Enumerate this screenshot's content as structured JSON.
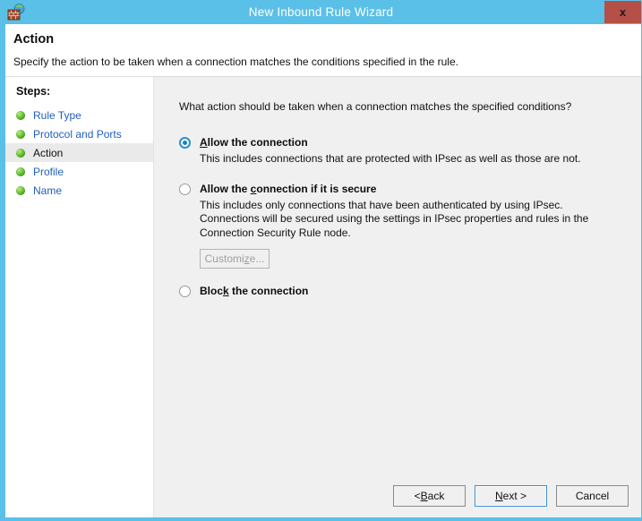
{
  "window": {
    "title": "New Inbound Rule Wizard",
    "icon": "firewall-globe-icon",
    "close_label": "x",
    "titlebar_color": "#5bc0e8",
    "close_button_color": "#b55048"
  },
  "header": {
    "title": "Action",
    "subtitle": "Specify the action to be taken when a connection matches the conditions specified in the rule."
  },
  "sidebar": {
    "heading": "Steps:",
    "items": [
      {
        "label": "Rule Type",
        "current": false
      },
      {
        "label": "Protocol and Ports",
        "current": false
      },
      {
        "label": "Action",
        "current": true
      },
      {
        "label": "Profile",
        "current": false
      },
      {
        "label": "Name",
        "current": false
      }
    ]
  },
  "content": {
    "question": "What action should be taken when a connection matches the specified conditions?",
    "options": [
      {
        "label_prefix": "",
        "accel": "A",
        "label_suffix": "llow the connection",
        "selected": true,
        "description": "This includes connections that are protected with IPsec as well as those are not."
      },
      {
        "label_prefix": "Allow the ",
        "accel": "c",
        "label_suffix": "onnection if it is secure",
        "selected": false,
        "description": "This includes only connections that have been authenticated by using IPsec.  Connections will be secured using the settings in IPsec properties and rules in the Connection Security Rule node."
      },
      {
        "label_prefix": "Bloc",
        "accel": "k",
        "label_suffix": " the connection",
        "selected": false,
        "description": ""
      }
    ],
    "customize_button": {
      "prefix": "Customi",
      "accel": "z",
      "suffix": "e...",
      "enabled": false
    }
  },
  "footer": {
    "back": {
      "prefix": "< ",
      "accel": "B",
      "suffix": "ack"
    },
    "next": {
      "prefix": "",
      "accel": "N",
      "suffix": "ext >",
      "default": true
    },
    "cancel": {
      "prefix": "Cancel",
      "accel": "",
      "suffix": ""
    }
  }
}
